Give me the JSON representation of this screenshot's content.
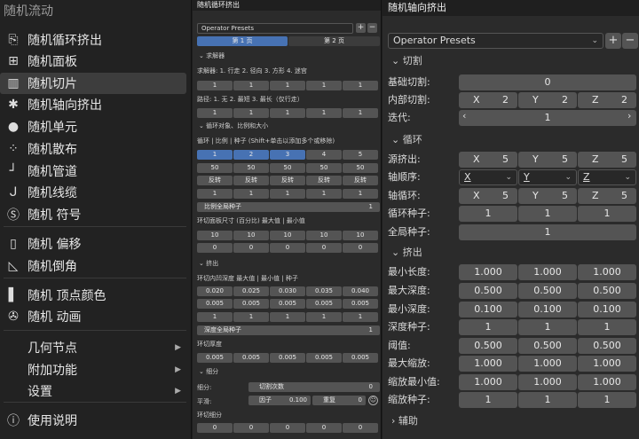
{
  "menu": {
    "title": "随机流动",
    "items": [
      {
        "label": "随机循环挤出",
        "icon": "extrude-icon"
      },
      {
        "label": "随机面板",
        "icon": "grid-icon"
      },
      {
        "label": "随机切片",
        "icon": "slice-icon"
      },
      {
        "label": "随机轴向挤出",
        "icon": "axis-extrude-icon"
      },
      {
        "label": "随机单元",
        "icon": "cell-icon"
      },
      {
        "label": "随机散布",
        "icon": "scatter-icon"
      },
      {
        "label": "随机管道",
        "icon": "pipe-icon"
      },
      {
        "label": "随机线缆",
        "icon": "cable-icon"
      },
      {
        "label": "随机 符号",
        "icon": "symbol-s-icon"
      },
      {
        "label": "随机 偏移",
        "icon": "offset-icon"
      },
      {
        "label": "随机倒角",
        "icon": "bevel-icon"
      },
      {
        "label": "随机 顶点颜色",
        "icon": "vertex-color-icon"
      },
      {
        "label": "随机 动画",
        "icon": "film-reel-icon"
      },
      {
        "label": "几何节点"
      },
      {
        "label": "附加功能"
      },
      {
        "label": "设置"
      },
      {
        "label": "使用说明",
        "icon": "info-icon"
      }
    ]
  },
  "p2": {
    "title": "随机循环挤出",
    "preset": "Operator Presets",
    "tab1": "第 1 页",
    "tab2": "第 2 页",
    "solver_head": "求解器",
    "solver_desc": "求解器: 1. 行走 2. 径向 3. 方形 4. 迷宫",
    "row1": [
      "1",
      "1",
      "1",
      "1",
      "1"
    ],
    "path_desc": "路径: 1. 无 2. 最短 3. 最长（仅行走）",
    "row2": [
      "1",
      "1",
      "1",
      "1",
      "1"
    ],
    "loop_head": "循环对象、比例和大小",
    "loop_desc": "循环 | 比例 | 种子 (Shift+单击以添加多个或移除)",
    "row3": [
      "1",
      "2",
      "3",
      "4",
      "5"
    ],
    "row4": [
      "50",
      "50",
      "50",
      "50",
      "50"
    ],
    "row5": [
      "反转",
      "反转",
      "反转",
      "反转",
      "反转"
    ],
    "row6": [
      "1",
      "1",
      "1",
      "1",
      "1"
    ],
    "scale_seed": "比例全局种子",
    "scale_seed_val": "1",
    "size_desc": "环切面板尺寸 (百分比) 最大值 | 最小值",
    "row7": [
      "10",
      "10",
      "10",
      "10",
      "10"
    ],
    "row8": [
      "0",
      "0",
      "0",
      "0",
      "0"
    ],
    "extrude_head": "挤出",
    "depth_desc": "环切内凹深度 最大值 | 最小值 | 种子",
    "row9": [
      "0.020",
      "0.025",
      "0.030",
      "0.035",
      "0.040"
    ],
    "row10": [
      "0.005",
      "0.005",
      "0.005",
      "0.005",
      "0.005"
    ],
    "row11": [
      "1",
      "1",
      "1",
      "1",
      "1"
    ],
    "depth_seed": "深度全局种子",
    "depth_seed_val": "1",
    "thick": "环切厚度",
    "row12": [
      "0.005",
      "0.005",
      "0.005",
      "0.005",
      "0.005"
    ],
    "sub_head": "细分",
    "sub_label": "细分:",
    "cuts": "切割次数",
    "cuts_val": "0",
    "smooth_label": "平滑:",
    "factor": "因子",
    "factor_val": "0.100",
    "repeat": "重复",
    "repeat_val": "0",
    "loop_sub": "环切细分",
    "row13": [
      "0",
      "0",
      "0",
      "0",
      "0"
    ]
  },
  "p3": {
    "title": "随机轴向挤出",
    "preset": "Operator Presets",
    "cut_head": "切割",
    "base_cut": "基础切割:",
    "base_cut_val": "0",
    "inner_cut": "内部切割:",
    "x": "X",
    "y": "Y",
    "z": "Z",
    "inner_vals": [
      "2",
      "2",
      "2"
    ],
    "iter": "迭代:",
    "iter_val": "1",
    "loop_head": "循环",
    "src": "源挤出:",
    "src_vals": [
      "5",
      "5",
      "5"
    ],
    "order": "轴顺序:",
    "order_vals": [
      "X",
      "Y",
      "Z"
    ],
    "axloop": "轴循环:",
    "axloop_vals": [
      "5",
      "5",
      "5"
    ],
    "lseed": "循环种子:",
    "lseed_vals": [
      "1",
      "1",
      "1"
    ],
    "gseed": "全局种子:",
    "gseed_val": "1",
    "ext_head": "挤出",
    "minlen": "最小长度:",
    "minlen_vals": [
      "1.000",
      "1.000",
      "1.000"
    ],
    "maxd": "最大深度:",
    "maxd_vals": [
      "0.500",
      "0.500",
      "0.500"
    ],
    "mind": "最小深度:",
    "mind_vals": [
      "0.100",
      "0.100",
      "0.100"
    ],
    "dseed": "深度种子:",
    "dseed_vals": [
      "1",
      "1",
      "1"
    ],
    "thr": "阈值:",
    "thr_vals": [
      "0.500",
      "0.500",
      "0.500"
    ],
    "maxs": "最大缩放:",
    "maxs_vals": [
      "1.000",
      "1.000",
      "1.000"
    ],
    "mins": "缩放最小值:",
    "mins_vals": [
      "1.000",
      "1.000",
      "1.000"
    ],
    "sseed": "缩放种子:",
    "sseed_vals": [
      "1",
      "1",
      "1"
    ],
    "aux": "辅助"
  }
}
